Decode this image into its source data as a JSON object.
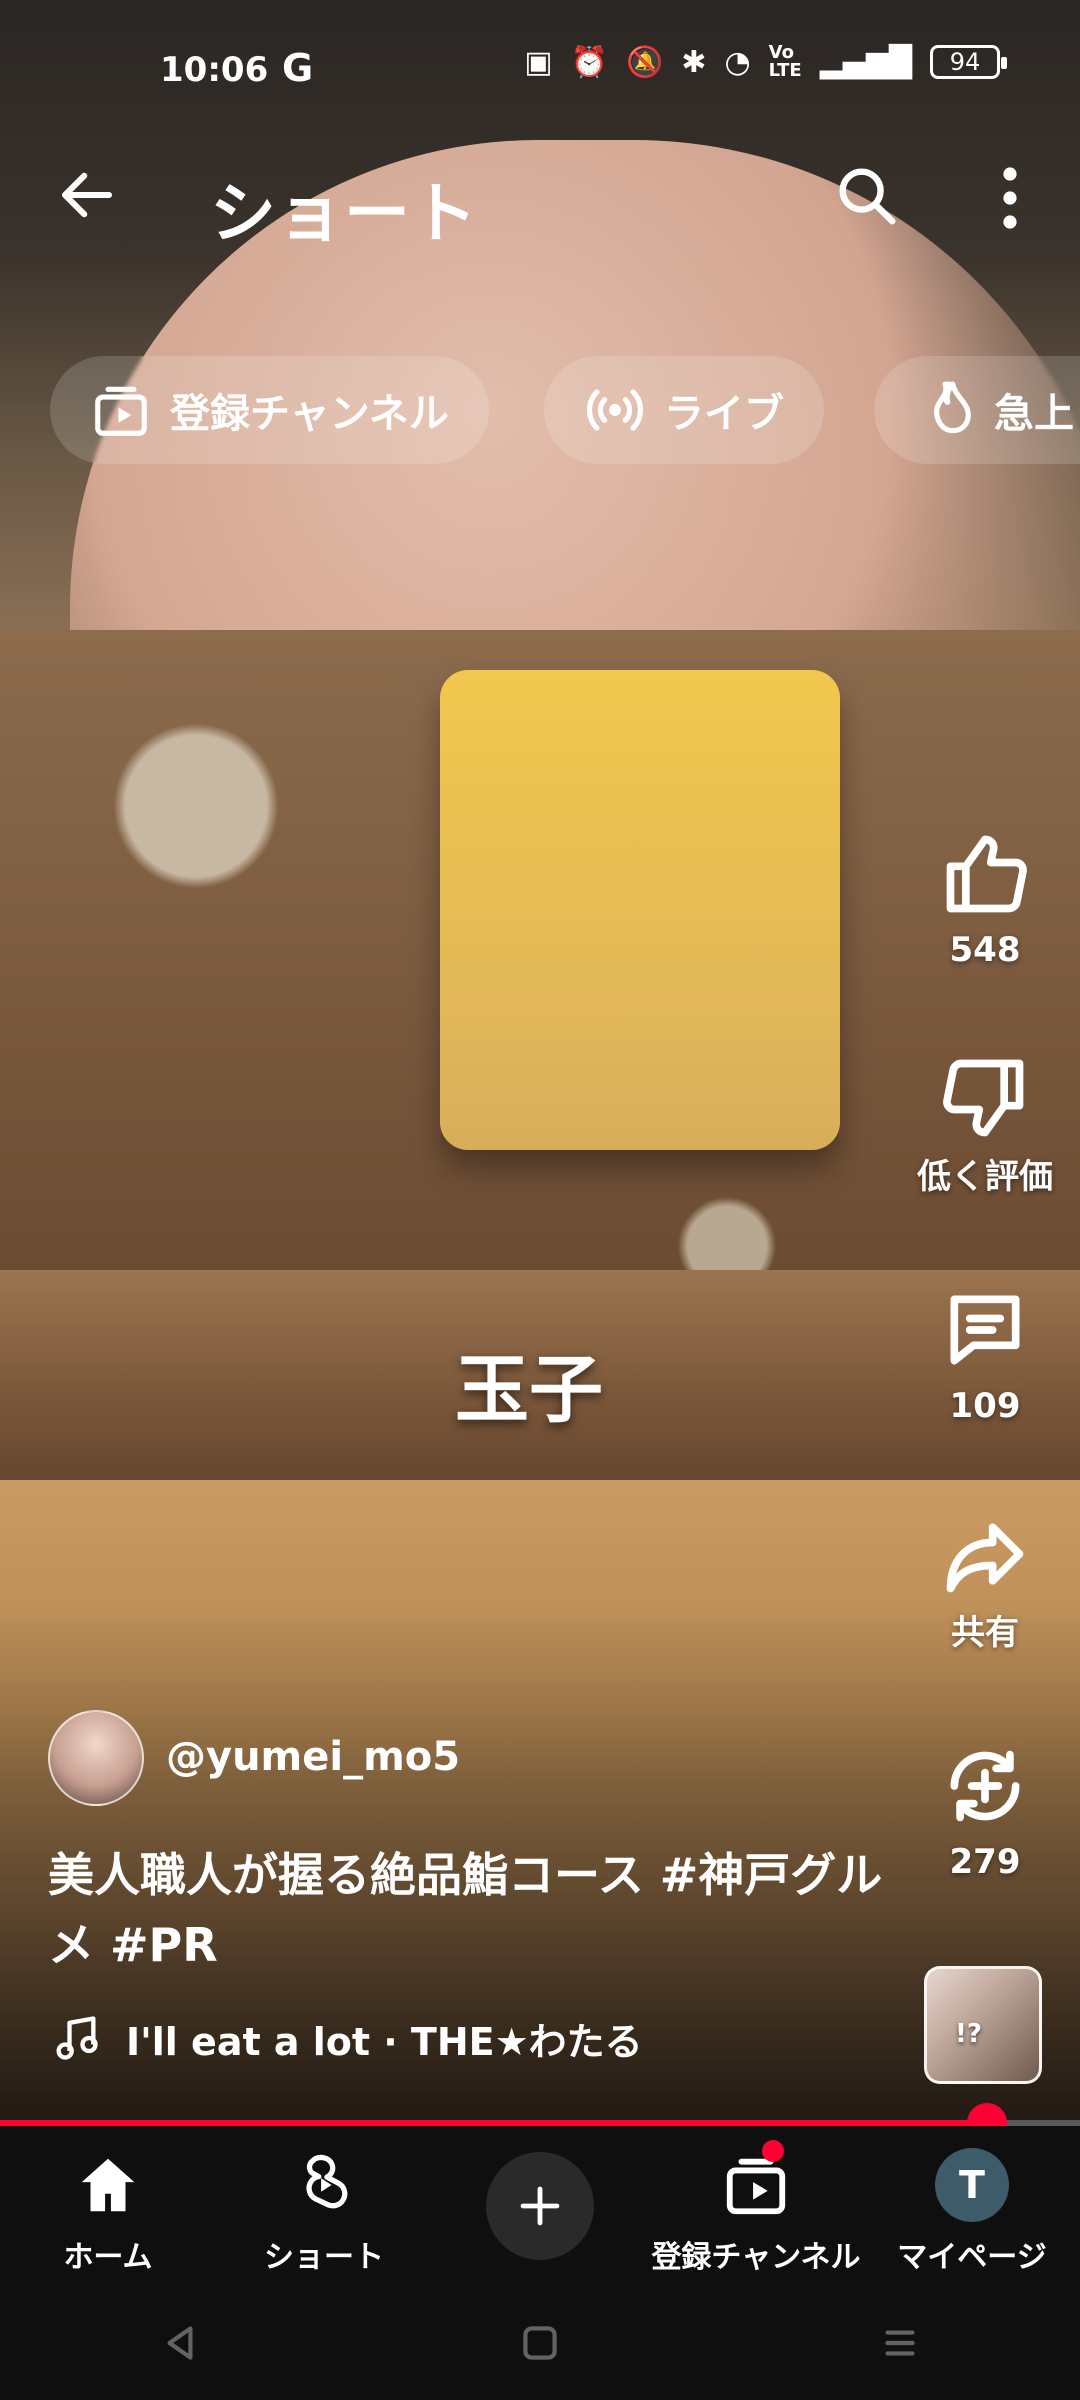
{
  "status_bar": {
    "time": "10:06",
    "google_glyph": "G",
    "battery_percent": "94",
    "icons": [
      "nfc-icon",
      "alarm-icon",
      "mute-icon",
      "bluetooth-icon",
      "wifi-icon",
      "volte-icon",
      "signal-icon"
    ]
  },
  "header": {
    "title": "ショート"
  },
  "chips": [
    {
      "icon": "subscriptions-icon",
      "label": "登録チャンネル"
    },
    {
      "icon": "live-icon",
      "label": "ライブ"
    },
    {
      "icon": "trending-icon",
      "label": "急上"
    }
  ],
  "overlay_text": "玉子",
  "actions": {
    "like_count": "548",
    "dislike_label": "低く評価",
    "comments_count": "109",
    "share_label": "共有",
    "remix_count": "279"
  },
  "video": {
    "channel_handle": "@yumei_mo5",
    "description_prefix": "美人職人が握る絶品鮨コース ",
    "hashtag_1": "#神戸グルメ",
    "hashtag_2": "#PR",
    "music": "I'll eat a lot · THE★わたる",
    "thumbnail_mark": "!?"
  },
  "playback": {
    "progress_fraction": 0.914
  },
  "bottom_nav": [
    {
      "label": "ホーム",
      "icon": "home-icon"
    },
    {
      "label": "ショート",
      "icon": "shorts-icon"
    },
    {
      "label": "",
      "icon": "plus-icon"
    },
    {
      "label": "登録チャンネル",
      "icon": "subscriptions-icon"
    },
    {
      "label": "マイページ",
      "icon": "profile-avatar",
      "avatar_letter": "T"
    }
  ],
  "colors": {
    "accent_red": "#ff0033",
    "nav_bg": "#0f0f0f"
  }
}
